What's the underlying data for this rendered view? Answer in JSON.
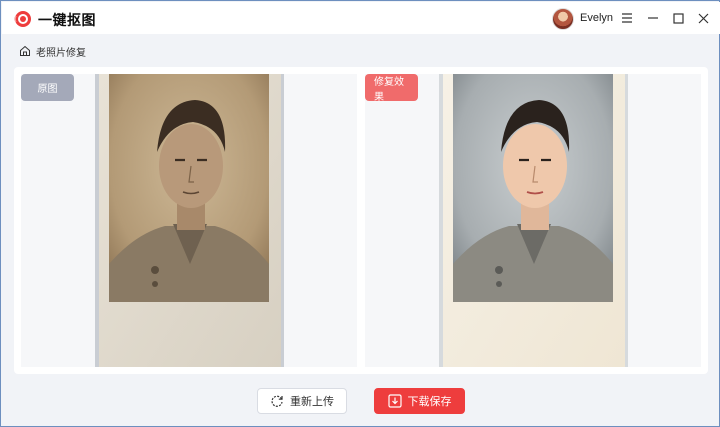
{
  "app": {
    "title": "一键抠图",
    "brand_color": "#ee3d3d"
  },
  "user": {
    "name": "Evelyn"
  },
  "window_controls": {
    "menu": "menu-icon",
    "minimize": "minimize-icon",
    "maximize": "maximize-icon",
    "close": "close-icon"
  },
  "breadcrumb": {
    "icon": "home-icon",
    "label": "老照片修复"
  },
  "compare": {
    "original_label": "原图",
    "result_label": "修复效果"
  },
  "actions": {
    "reupload_label": "重新上传",
    "download_label": "下载保存"
  }
}
